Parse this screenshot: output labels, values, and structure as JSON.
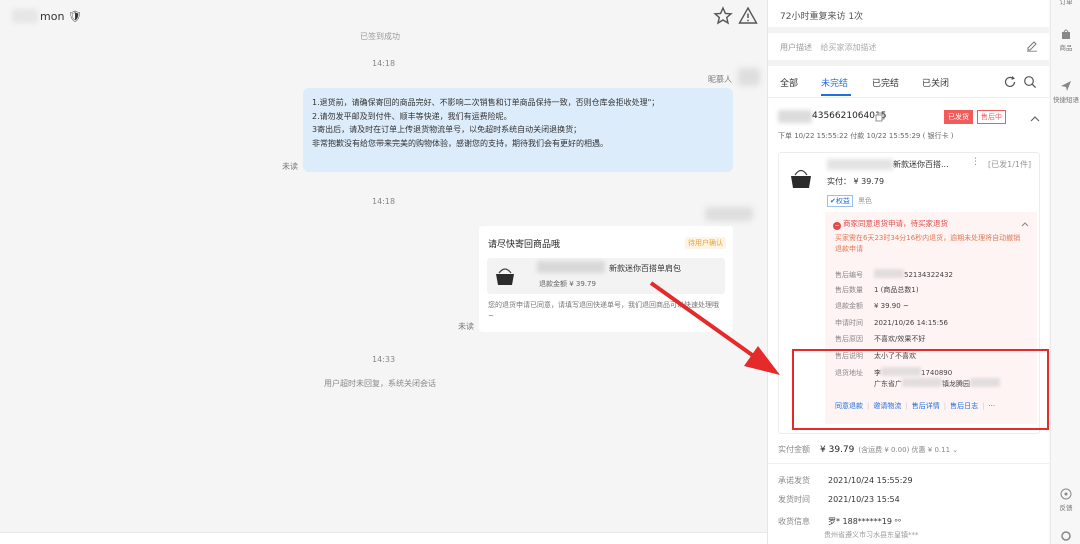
{
  "chat": {
    "title": "mon 🛡",
    "sub_note": "已签到成功",
    "time_1": "14:18",
    "sender_label": "昵慕人",
    "message_lines": [
      "1.退货前，请确保寄回的商品完好、不影响二次销售和订单商品保持一致，否则仓库会拒收处理\"；",
      "2.请勿发平邮及到付件、顺丰等快递，我们有运费险呢。",
      "3寄出后，请及时在订单上传退货物流单号，以免超时系统自动关闭退换货；",
      "非常抱歉没有给您带来完美的购物体验，感谢您的支持，期待我们会有更好的相遇。"
    ],
    "unread_1": "未读",
    "time_2": "14:18",
    "card": {
      "title": "请尽快寄回商品哦",
      "tag": "待用户确认",
      "goods_name": "新款迷你百搭单肩包",
      "refund_amount": "退款金额 ¥ 39.79",
      "desc": "您的退货申请已同意，请填写退回快递单号，我们退回商品可以快速处理哦~"
    },
    "unread_2": "未读",
    "time_3": "14:33",
    "system_note": "用户超时未回复，系统关闭会话"
  },
  "panel": {
    "revisit": "72小时重复来访  1次",
    "desc_label": "用户描述",
    "desc_placeholder": "给买家添加描述",
    "tabs": [
      "全部",
      "未完结",
      "已完结",
      "已关闭"
    ],
    "order_id": "4356621064015",
    "badge_shipped": "已发货",
    "badge_after_sale": "售后中",
    "order_meta": "下单 10/22 15:55:22  付款 10/22 15:55:29 ( 银行卡 )",
    "goods_name": "新款迷你百搭...",
    "goods_more": "⋮",
    "goods_count": "[已发1/1件]",
    "goods_paid": "实付： ¥ 39.79",
    "guarantee": "✔权益",
    "goods_color": "黑色",
    "refund": {
      "head": "商家同意退货申请，待买家退货",
      "note": "买家需在6天23时34分16秒内退货，逾期未处理将自动撤销退款申请",
      "rows": [
        {
          "k": "售后编号",
          "v": "52134322432"
        },
        {
          "k": "售后数量",
          "v": "1 (商品总数1)"
        },
        {
          "k": "退款金额",
          "v": "¥ 39.90 ~"
        },
        {
          "k": "申请时间",
          "v": "2021/10/26 14:15:56"
        },
        {
          "k": "售后原因",
          "v": "不喜欢/效果不好"
        },
        {
          "k": "售后说明",
          "v": "太小了不喜欢"
        }
      ],
      "addr_label": "退货地址",
      "addr_line1": "李",
      "addr_phone": "1740890",
      "addr_line2": "广东省广",
      "addr_line2b": "镇龙腾园",
      "actions": [
        "同意退款",
        "邀请物流",
        "售后详情",
        "售后日志",
        "···"
      ]
    },
    "sum_label": "实付金额",
    "sum_price": "¥ 39.79",
    "sum_sub": "(含运费 ¥ 0.00)  优惠 ¥ 0.11 ⌄",
    "promise_label": "承诺发货",
    "promise_value": "2021/10/24 15:55:29",
    "ship_label": "发货时间",
    "ship_value": "2021/10/23 15:54",
    "recv_label": "收货信息",
    "recv_value": "罗*  188******19  ᵒᵒ",
    "recv_addr": "贵州省遵义市习水县东皇镇***"
  },
  "strip": {
    "items": [
      "订单",
      "商品",
      "快捷短语",
      "反馈",
      "设置"
    ]
  },
  "colors": {
    "accent": "#1f6fde",
    "alert_red": "#e52a2a",
    "bubble_blue": "#dcecfb"
  }
}
